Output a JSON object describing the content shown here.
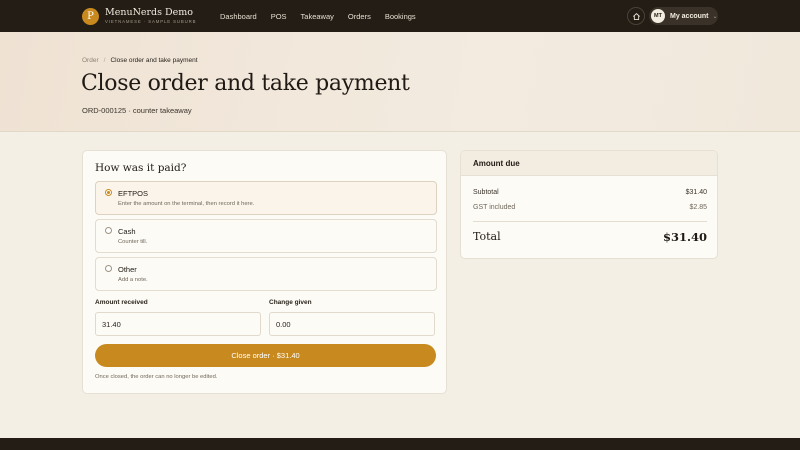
{
  "nav": {
    "logo_letter": "P",
    "brand_name": "MenuNerds Demo",
    "brand_sub": "VIETNAMESE · SAMPLE SUBURB",
    "links": [
      "Dashboard",
      "POS",
      "Takeaway",
      "Orders",
      "Bookings"
    ],
    "home_icon": "home-icon",
    "avatar_initials": "MT",
    "account_label": "My account",
    "account_chevron": "chevron-down-icon"
  },
  "breadcrumb": {
    "parent": "Order",
    "separator": "/",
    "current": "Close order and take payment"
  },
  "page": {
    "title": "Close order and take payment",
    "subtitle": "ORD-000125 · counter takeaway"
  },
  "payment": {
    "title": "How was it paid?",
    "options": [
      {
        "label": "EFTPOS",
        "help": "Enter the amount on the terminal, then record it here.",
        "selected": true
      },
      {
        "label": "Cash",
        "help": "Counter till.",
        "selected": false
      },
      {
        "label": "Other",
        "help": "Add a note.",
        "selected": false
      }
    ],
    "amount_received_label": "Amount received",
    "amount_received_value": "31.40",
    "change_given_label": "Change given",
    "change_given_value": "0.00",
    "close_button": "Close order · $31.40",
    "close_note": "Once closed, the order can no longer be edited."
  },
  "summary": {
    "title": "Amount due",
    "subtotal_label": "Subtotal",
    "subtotal_value": "$31.40",
    "gst_label": "GST included",
    "gst_value": "$2.85",
    "total_label": "Total",
    "total_value": "$31.40"
  },
  "colors": {
    "accent": "#c8891f",
    "nav_bg": "#231d16",
    "page_bg": "#f4efe5"
  }
}
